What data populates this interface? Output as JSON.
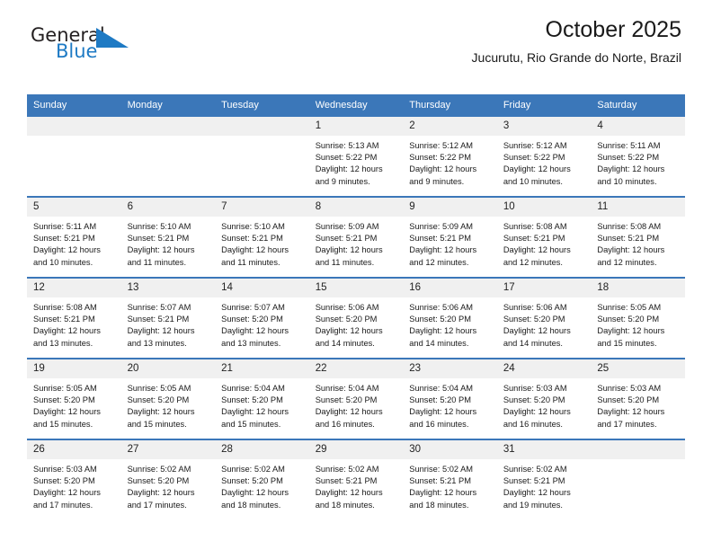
{
  "brand": {
    "name_top": "General",
    "name_bottom": "Blue",
    "triangle_icon": "blue-triangle-icon",
    "accent_color": "#1e7ac4",
    "text_color": "#231f20"
  },
  "header": {
    "title": "October 2025",
    "subtitle": "Jucurutu, Rio Grande do Norte, Brazil"
  },
  "theme": {
    "header_row_color": "#3b77b9",
    "daynum_band_color": "#f0f0f0",
    "page_background": "#ffffff"
  },
  "calendar": {
    "weekday_headers": [
      "Sunday",
      "Monday",
      "Tuesday",
      "Wednesday",
      "Thursday",
      "Friday",
      "Saturday"
    ],
    "weeks": [
      [
        {
          "day": "",
          "sunrise": "",
          "sunset": "",
          "daylight_line1": "",
          "daylight_line2": ""
        },
        {
          "day": "",
          "sunrise": "",
          "sunset": "",
          "daylight_line1": "",
          "daylight_line2": ""
        },
        {
          "day": "",
          "sunrise": "",
          "sunset": "",
          "daylight_line1": "",
          "daylight_line2": ""
        },
        {
          "day": "1",
          "sunrise": "Sunrise: 5:13 AM",
          "sunset": "Sunset: 5:22 PM",
          "daylight_line1": "Daylight: 12 hours",
          "daylight_line2": "and 9 minutes."
        },
        {
          "day": "2",
          "sunrise": "Sunrise: 5:12 AM",
          "sunset": "Sunset: 5:22 PM",
          "daylight_line1": "Daylight: 12 hours",
          "daylight_line2": "and 9 minutes."
        },
        {
          "day": "3",
          "sunrise": "Sunrise: 5:12 AM",
          "sunset": "Sunset: 5:22 PM",
          "daylight_line1": "Daylight: 12 hours",
          "daylight_line2": "and 10 minutes."
        },
        {
          "day": "4",
          "sunrise": "Sunrise: 5:11 AM",
          "sunset": "Sunset: 5:22 PM",
          "daylight_line1": "Daylight: 12 hours",
          "daylight_line2": "and 10 minutes."
        }
      ],
      [
        {
          "day": "5",
          "sunrise": "Sunrise: 5:11 AM",
          "sunset": "Sunset: 5:21 PM",
          "daylight_line1": "Daylight: 12 hours",
          "daylight_line2": "and 10 minutes."
        },
        {
          "day": "6",
          "sunrise": "Sunrise: 5:10 AM",
          "sunset": "Sunset: 5:21 PM",
          "daylight_line1": "Daylight: 12 hours",
          "daylight_line2": "and 11 minutes."
        },
        {
          "day": "7",
          "sunrise": "Sunrise: 5:10 AM",
          "sunset": "Sunset: 5:21 PM",
          "daylight_line1": "Daylight: 12 hours",
          "daylight_line2": "and 11 minutes."
        },
        {
          "day": "8",
          "sunrise": "Sunrise: 5:09 AM",
          "sunset": "Sunset: 5:21 PM",
          "daylight_line1": "Daylight: 12 hours",
          "daylight_line2": "and 11 minutes."
        },
        {
          "day": "9",
          "sunrise": "Sunrise: 5:09 AM",
          "sunset": "Sunset: 5:21 PM",
          "daylight_line1": "Daylight: 12 hours",
          "daylight_line2": "and 12 minutes."
        },
        {
          "day": "10",
          "sunrise": "Sunrise: 5:08 AM",
          "sunset": "Sunset: 5:21 PM",
          "daylight_line1": "Daylight: 12 hours",
          "daylight_line2": "and 12 minutes."
        },
        {
          "day": "11",
          "sunrise": "Sunrise: 5:08 AM",
          "sunset": "Sunset: 5:21 PM",
          "daylight_line1": "Daylight: 12 hours",
          "daylight_line2": "and 12 minutes."
        }
      ],
      [
        {
          "day": "12",
          "sunrise": "Sunrise: 5:08 AM",
          "sunset": "Sunset: 5:21 PM",
          "daylight_line1": "Daylight: 12 hours",
          "daylight_line2": "and 13 minutes."
        },
        {
          "day": "13",
          "sunrise": "Sunrise: 5:07 AM",
          "sunset": "Sunset: 5:21 PM",
          "daylight_line1": "Daylight: 12 hours",
          "daylight_line2": "and 13 minutes."
        },
        {
          "day": "14",
          "sunrise": "Sunrise: 5:07 AM",
          "sunset": "Sunset: 5:20 PM",
          "daylight_line1": "Daylight: 12 hours",
          "daylight_line2": "and 13 minutes."
        },
        {
          "day": "15",
          "sunrise": "Sunrise: 5:06 AM",
          "sunset": "Sunset: 5:20 PM",
          "daylight_line1": "Daylight: 12 hours",
          "daylight_line2": "and 14 minutes."
        },
        {
          "day": "16",
          "sunrise": "Sunrise: 5:06 AM",
          "sunset": "Sunset: 5:20 PM",
          "daylight_line1": "Daylight: 12 hours",
          "daylight_line2": "and 14 minutes."
        },
        {
          "day": "17",
          "sunrise": "Sunrise: 5:06 AM",
          "sunset": "Sunset: 5:20 PM",
          "daylight_line1": "Daylight: 12 hours",
          "daylight_line2": "and 14 minutes."
        },
        {
          "day": "18",
          "sunrise": "Sunrise: 5:05 AM",
          "sunset": "Sunset: 5:20 PM",
          "daylight_line1": "Daylight: 12 hours",
          "daylight_line2": "and 15 minutes."
        }
      ],
      [
        {
          "day": "19",
          "sunrise": "Sunrise: 5:05 AM",
          "sunset": "Sunset: 5:20 PM",
          "daylight_line1": "Daylight: 12 hours",
          "daylight_line2": "and 15 minutes."
        },
        {
          "day": "20",
          "sunrise": "Sunrise: 5:05 AM",
          "sunset": "Sunset: 5:20 PM",
          "daylight_line1": "Daylight: 12 hours",
          "daylight_line2": "and 15 minutes."
        },
        {
          "day": "21",
          "sunrise": "Sunrise: 5:04 AM",
          "sunset": "Sunset: 5:20 PM",
          "daylight_line1": "Daylight: 12 hours",
          "daylight_line2": "and 15 minutes."
        },
        {
          "day": "22",
          "sunrise": "Sunrise: 5:04 AM",
          "sunset": "Sunset: 5:20 PM",
          "daylight_line1": "Daylight: 12 hours",
          "daylight_line2": "and 16 minutes."
        },
        {
          "day": "23",
          "sunrise": "Sunrise: 5:04 AM",
          "sunset": "Sunset: 5:20 PM",
          "daylight_line1": "Daylight: 12 hours",
          "daylight_line2": "and 16 minutes."
        },
        {
          "day": "24",
          "sunrise": "Sunrise: 5:03 AM",
          "sunset": "Sunset: 5:20 PM",
          "daylight_line1": "Daylight: 12 hours",
          "daylight_line2": "and 16 minutes."
        },
        {
          "day": "25",
          "sunrise": "Sunrise: 5:03 AM",
          "sunset": "Sunset: 5:20 PM",
          "daylight_line1": "Daylight: 12 hours",
          "daylight_line2": "and 17 minutes."
        }
      ],
      [
        {
          "day": "26",
          "sunrise": "Sunrise: 5:03 AM",
          "sunset": "Sunset: 5:20 PM",
          "daylight_line1": "Daylight: 12 hours",
          "daylight_line2": "and 17 minutes."
        },
        {
          "day": "27",
          "sunrise": "Sunrise: 5:02 AM",
          "sunset": "Sunset: 5:20 PM",
          "daylight_line1": "Daylight: 12 hours",
          "daylight_line2": "and 17 minutes."
        },
        {
          "day": "28",
          "sunrise": "Sunrise: 5:02 AM",
          "sunset": "Sunset: 5:20 PM",
          "daylight_line1": "Daylight: 12 hours",
          "daylight_line2": "and 18 minutes."
        },
        {
          "day": "29",
          "sunrise": "Sunrise: 5:02 AM",
          "sunset": "Sunset: 5:21 PM",
          "daylight_line1": "Daylight: 12 hours",
          "daylight_line2": "and 18 minutes."
        },
        {
          "day": "30",
          "sunrise": "Sunrise: 5:02 AM",
          "sunset": "Sunset: 5:21 PM",
          "daylight_line1": "Daylight: 12 hours",
          "daylight_line2": "and 18 minutes."
        },
        {
          "day": "31",
          "sunrise": "Sunrise: 5:02 AM",
          "sunset": "Sunset: 5:21 PM",
          "daylight_line1": "Daylight: 12 hours",
          "daylight_line2": "and 19 minutes."
        },
        {
          "day": "",
          "sunrise": "",
          "sunset": "",
          "daylight_line1": "",
          "daylight_line2": ""
        }
      ]
    ]
  }
}
